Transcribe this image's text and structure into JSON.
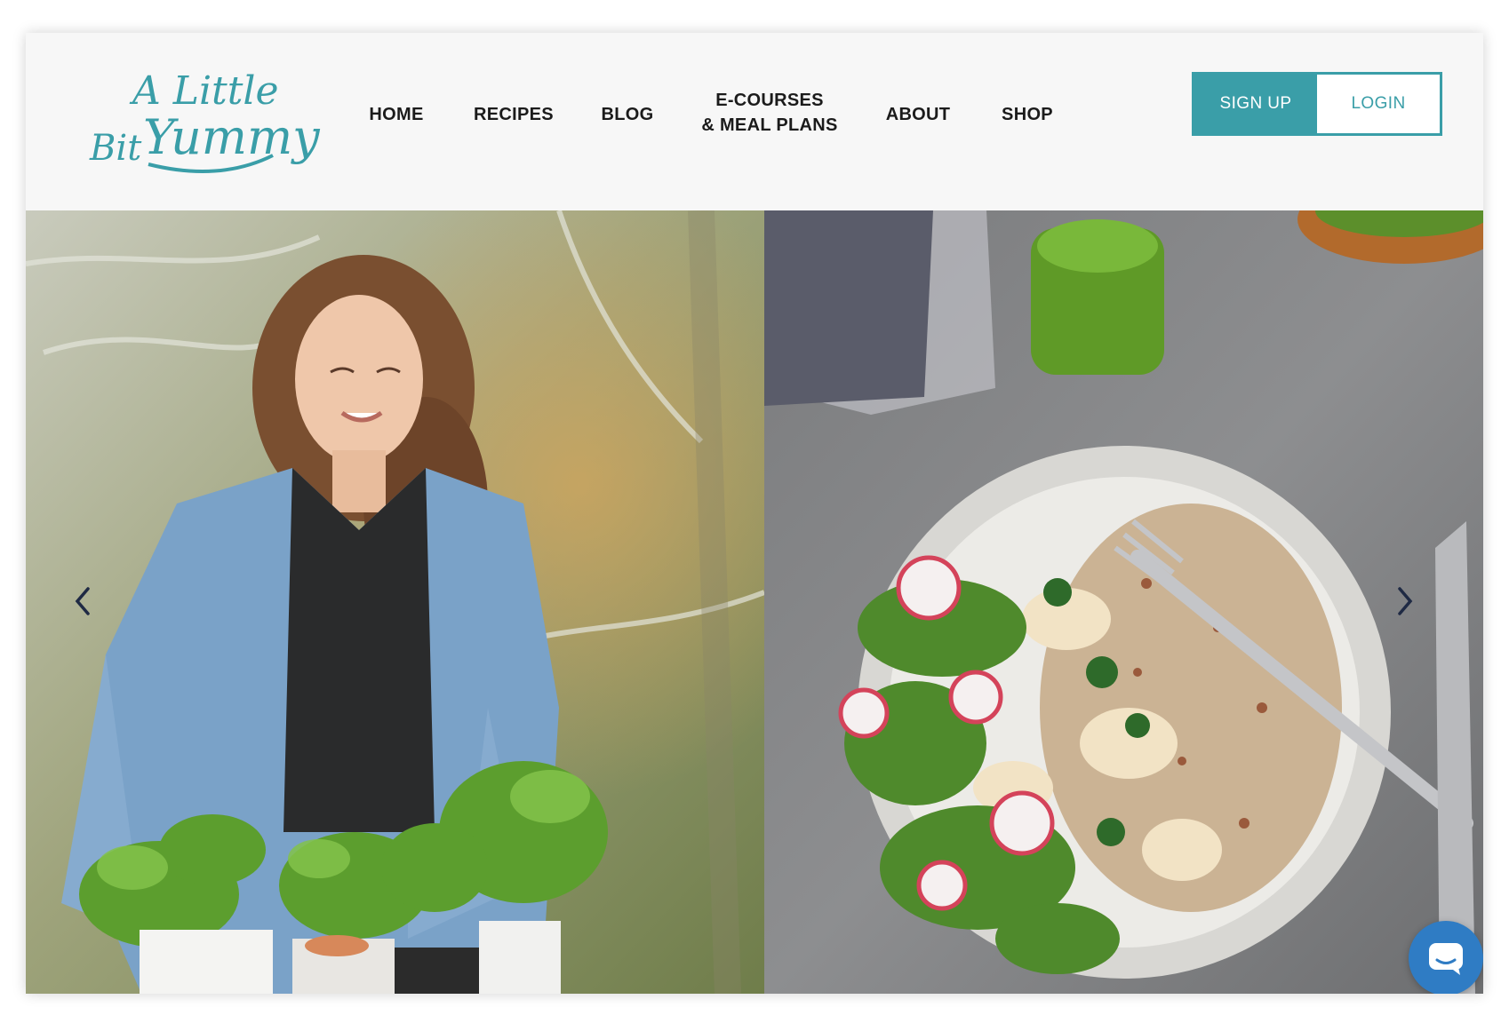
{
  "brand": {
    "logo_line1": "A Little",
    "logo_line2_left": "Bit",
    "logo_line2_right": "Yummy",
    "color": "#3a9ea8"
  },
  "nav": {
    "items": [
      {
        "label": "HOME"
      },
      {
        "label": "RECIPES"
      },
      {
        "label": "BLOG"
      },
      {
        "label": "E-COURSES\n& MEAL PLANS"
      },
      {
        "label": "ABOUT"
      },
      {
        "label": "SHOP"
      }
    ]
  },
  "auth": {
    "signup_label": "SIGN UP",
    "login_label": "LOGIN"
  },
  "carousel": {
    "prev_icon": "chevron-left-icon",
    "next_icon": "chevron-right-icon",
    "slides": [
      {
        "subject": "woman-with-herb-pots-photo"
      },
      {
        "subject": "salad-bowl-photo"
      }
    ]
  },
  "chat": {
    "icon": "chat-bubble-icon",
    "color": "#2f7cc4"
  },
  "colors": {
    "accent": "#3a9ea8",
    "header_bg": "#f7f7f7",
    "nav_text": "#1b1b1b"
  }
}
